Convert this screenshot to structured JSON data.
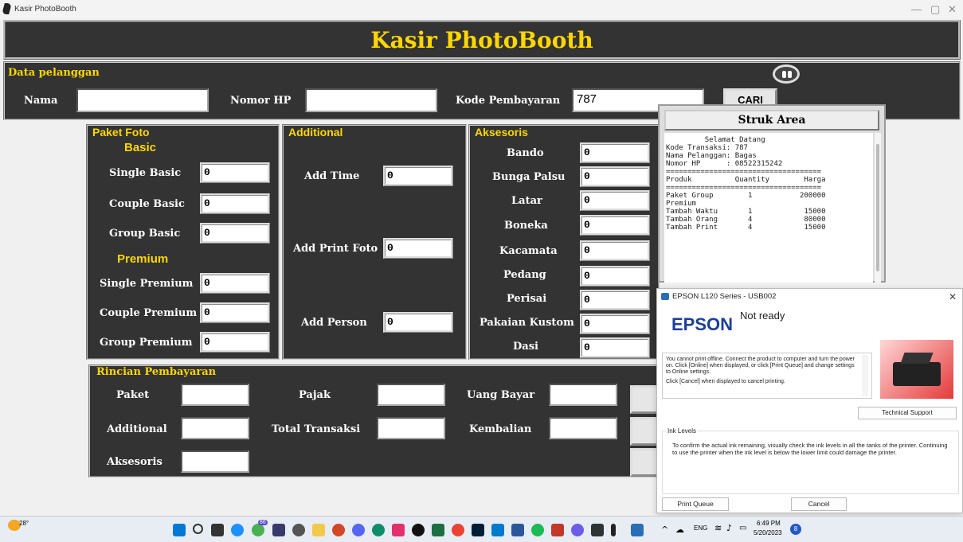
{
  "window": {
    "title": "Kasir PhotoBooth",
    "controls": [
      "—",
      "▢",
      "✕"
    ]
  },
  "app": {
    "heading": "Kasir PhotoBooth"
  },
  "data_pelanggan": {
    "legend": "Data pelanggan",
    "nama_label": "Nama",
    "nama_value": "",
    "hp_label": "Nomor HP",
    "hp_value": "",
    "kode_label": "Kode Pembayaran",
    "kode_value": "787",
    "cari_button": "CARI"
  },
  "paket_foto": {
    "legend": "Paket Foto",
    "basic_heading": "Basic",
    "premium_heading": "Premium",
    "items": [
      {
        "label": "Single Basic",
        "value": "0"
      },
      {
        "label": "Couple Basic",
        "value": "0"
      },
      {
        "label": "Group Basic",
        "value": "0"
      },
      {
        "label": "Single Premium",
        "value": "0"
      },
      {
        "label": "Couple Premium",
        "value": "0"
      },
      {
        "label": "Group Premium",
        "value": "0"
      }
    ]
  },
  "additional": {
    "legend": "Additional",
    "items": [
      {
        "label": "Add Time",
        "value": "0"
      },
      {
        "label": "Add Print Foto",
        "value": "0"
      },
      {
        "label": "Add Person",
        "value": "0"
      }
    ]
  },
  "aksesoris": {
    "legend": "Aksesoris",
    "items": [
      {
        "label": "Bando",
        "value": "0"
      },
      {
        "label": "Bunga Palsu",
        "value": "0"
      },
      {
        "label": "Latar",
        "value": "0"
      },
      {
        "label": "Boneka",
        "value": "0"
      },
      {
        "label": "Kacamata",
        "value": "0"
      },
      {
        "label": "Pedang",
        "value": "0"
      },
      {
        "label": "Perisai",
        "value": "0"
      },
      {
        "label": "Pakaian Kustom",
        "value": "0"
      },
      {
        "label": "Dasi",
        "value": "0"
      }
    ]
  },
  "rincian": {
    "legend": "Rincian Pembayaran",
    "paket": "Paket",
    "additional": "Additional",
    "aksesoris": "Aksesoris",
    "pajak": "Pajak",
    "total": "Total Transaksi",
    "uang_bayar": "Uang Bayar",
    "kembalian": "Kembalian"
  },
  "struk": {
    "header": "Struk Area",
    "lines": [
      "         Selamat Datang",
      "",
      "Kode Transaksi: 787",
      "Nama Pelanggan: Bagas",
      "Nomor HP      : 08522315242",
      "====================================",
      "Produk          Quantity        Harga",
      "====================================",
      "Paket Group        1           200000",
      "Premium",
      "Tambah Waktu       1            15000",
      "Tambah Orang       4            80000",
      "Tambah Print       4            15000"
    ]
  },
  "epson_dialog": {
    "title": "EPSON L120 Series - USB002",
    "logo": "EPSON",
    "status": "Not ready",
    "message1": "You cannot print offline. Connect the product to computer and turn the power on. Click [Online] when displayed, or click [Print Queue] and change settings to Online settings.",
    "message2": "Click [Cancel] when displayed to cancel printing.",
    "technical_support": "Technical Support",
    "ink_levels_label": "Ink Levels",
    "ink_text": "To confirm the actual ink remaining, visually check the ink levels in all the tanks of the printer. Continuing to use the printer when the ink level is below the lower limit could damage the printer.",
    "print_queue": "Print Queue",
    "cancel": "Cancel"
  },
  "taskbar": {
    "weather": "28°",
    "lang": "ENG",
    "time": "6:49 PM",
    "date": "5/20/2023",
    "notif": "8",
    "badge_count": "86"
  }
}
